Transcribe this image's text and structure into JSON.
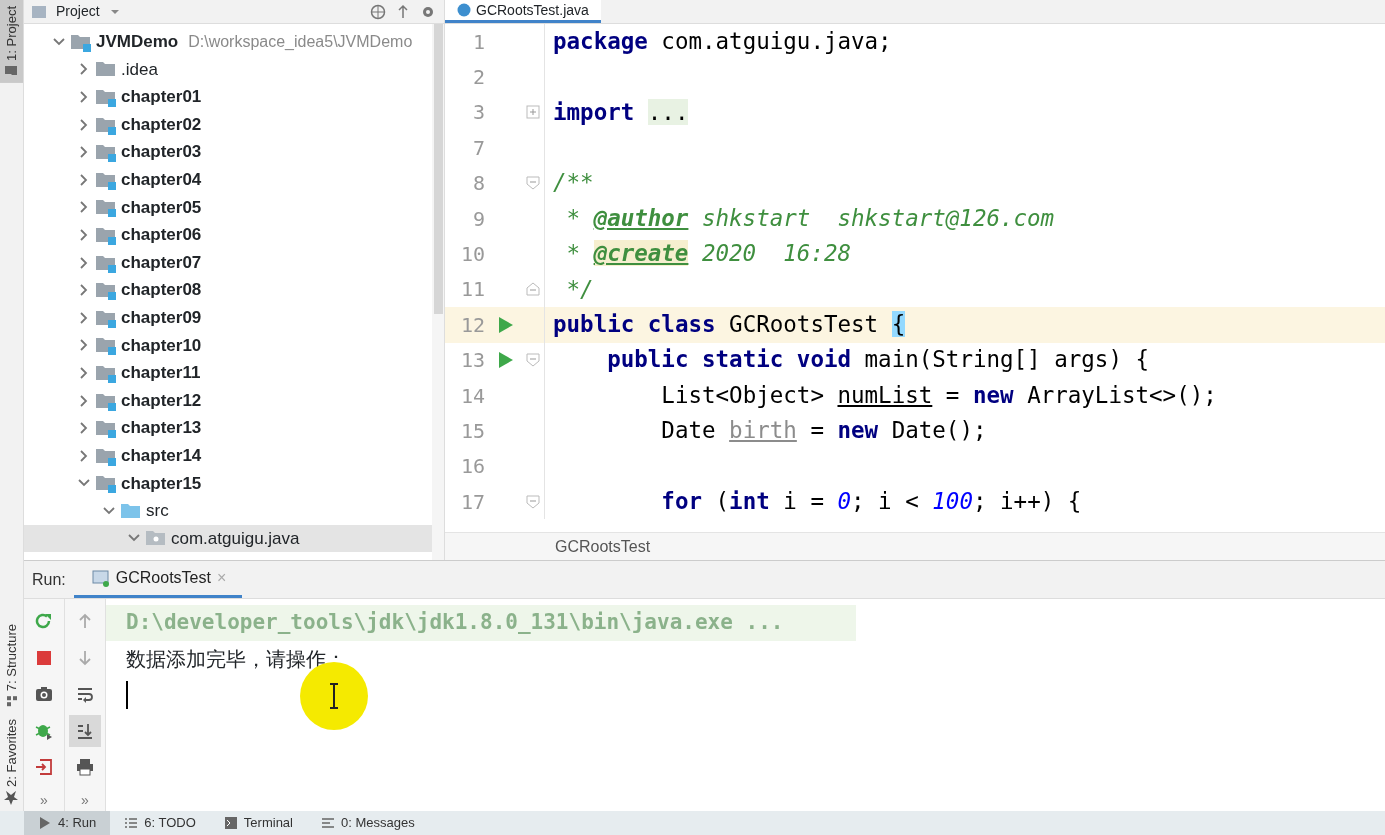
{
  "side_strip": [
    {
      "label": "1: Project",
      "selected": true
    },
    {
      "label": "7: Structure",
      "selected": false
    },
    {
      "label": "2: Favorites",
      "selected": false
    }
  ],
  "project_pane": {
    "title": "Project",
    "tree": [
      {
        "name": "JVMDemo",
        "path": "D:\\workspace_idea5\\JVMDemo",
        "kind": "module",
        "bold": true,
        "expanded": true,
        "selected": false,
        "children": [
          {
            "name": ".idea",
            "kind": "folder",
            "bold": false,
            "expanded": false,
            "selected": false
          },
          {
            "name": "chapter01",
            "kind": "module",
            "bold": true,
            "expanded": false,
            "selected": false
          },
          {
            "name": "chapter02",
            "kind": "module",
            "bold": true,
            "expanded": false,
            "selected": false
          },
          {
            "name": "chapter03",
            "kind": "module",
            "bold": true,
            "expanded": false,
            "selected": false
          },
          {
            "name": "chapter04",
            "kind": "module",
            "bold": true,
            "expanded": false,
            "selected": false
          },
          {
            "name": "chapter05",
            "kind": "module",
            "bold": true,
            "expanded": false,
            "selected": false
          },
          {
            "name": "chapter06",
            "kind": "module",
            "bold": true,
            "expanded": false,
            "selected": false
          },
          {
            "name": "chapter07",
            "kind": "module",
            "bold": true,
            "expanded": false,
            "selected": false
          },
          {
            "name": "chapter08",
            "kind": "module",
            "bold": true,
            "expanded": false,
            "selected": false
          },
          {
            "name": "chapter09",
            "kind": "module",
            "bold": true,
            "expanded": false,
            "selected": false
          },
          {
            "name": "chapter10",
            "kind": "module",
            "bold": true,
            "expanded": false,
            "selected": false
          },
          {
            "name": "chapter11",
            "kind": "module",
            "bold": true,
            "expanded": false,
            "selected": false
          },
          {
            "name": "chapter12",
            "kind": "module",
            "bold": true,
            "expanded": false,
            "selected": false
          },
          {
            "name": "chapter13",
            "kind": "module",
            "bold": true,
            "expanded": false,
            "selected": false
          },
          {
            "name": "chapter14",
            "kind": "module",
            "bold": true,
            "expanded": false,
            "selected": false
          },
          {
            "name": "chapter15",
            "kind": "module",
            "bold": true,
            "expanded": true,
            "selected": false,
            "children": [
              {
                "name": "src",
                "kind": "source",
                "bold": false,
                "expanded": true,
                "selected": false,
                "children": [
                  {
                    "name": "com.atguigu.java",
                    "kind": "package",
                    "bold": false,
                    "expanded": true,
                    "selected": true
                  }
                ]
              }
            ]
          }
        ]
      }
    ]
  },
  "editor": {
    "tab": "GCRootsTest.java",
    "lines": [
      {
        "number": "1",
        "run": false,
        "current": false,
        "tokens": [
          {
            "kind": "keyword",
            "text": "package"
          },
          {
            "kind": "plain",
            "text": " com.atguigu.java;"
          }
        ]
      },
      {
        "number": "2",
        "run": false,
        "current": false
      },
      {
        "number": "3",
        "run": false,
        "fold_marker": {
          "kind": "expand"
        },
        "current": false,
        "tokens": [
          {
            "kind": "keyword",
            "text": "import "
          },
          {
            "kind": "folded",
            "text": "..."
          }
        ]
      },
      {
        "number": "7",
        "run": false,
        "current": false
      },
      {
        "number": "8",
        "run": false,
        "fold_marker": {
          "kind": "start"
        },
        "current": false,
        "tokens": [
          {
            "kind": "comment",
            "text": "/**"
          }
        ]
      },
      {
        "number": "9",
        "run": false,
        "current": false,
        "tokens": [
          {
            "kind": "comment",
            "text": " *"
          },
          {
            "kind": "doctag",
            "text": "@author"
          },
          {
            "kind": "comment",
            "text": " shkstart  shkstart@126.com"
          }
        ]
      },
      {
        "number": "10",
        "run": false,
        "current": false,
        "tokens": [
          {
            "kind": "comment",
            "text": " *"
          },
          {
            "kind": "doctag-marked",
            "text": "@create"
          },
          {
            "kind": "comment",
            "text": " 2020  16:28"
          }
        ]
      },
      {
        "number": "11",
        "run": false,
        "fold_marker": {
          "kind": "end"
        },
        "current": false,
        "tokens": [
          {
            "kind": "comment",
            "text": " */"
          }
        ]
      },
      {
        "number": "12",
        "run": true,
        "current": true,
        "tokens": [
          {
            "kind": "keyword",
            "text": "public class"
          },
          {
            "kind": "plain",
            "text": " GCRootsTest "
          },
          {
            "kind": "brace-match",
            "text": "{"
          }
        ]
      },
      {
        "number": "13",
        "run": true,
        "fold_marker": {
          "kind": "start"
        },
        "current": false,
        "tokens": [
          {
            "kind": "keyword",
            "text": "    public static void"
          },
          {
            "kind": "plain",
            "text": " main(String[] args) {"
          }
        ]
      },
      {
        "number": "14",
        "run": false,
        "current": false,
        "tokens": [
          {
            "kind": "plain",
            "text": "        List<Object> "
          },
          {
            "kind": "underlined",
            "text": "numList"
          },
          {
            "kind": "plain",
            "text": " = "
          },
          {
            "kind": "keyword",
            "text": "new"
          },
          {
            "kind": "plain",
            "text": " ArrayList<>();"
          }
        ]
      },
      {
        "number": "15",
        "run": false,
        "current": false,
        "tokens": [
          {
            "kind": "plain",
            "text": "        Date "
          },
          {
            "kind": "unused",
            "text": "birth"
          },
          {
            "kind": "plain",
            "text": " = "
          },
          {
            "kind": "keyword",
            "text": "new"
          },
          {
            "kind": "plain",
            "text": " Date();"
          }
        ]
      },
      {
        "number": "16",
        "run": false,
        "current": false
      },
      {
        "number": "17",
        "run": false,
        "fold_marker": {
          "kind": "start"
        },
        "current": false,
        "tokens": [
          {
            "kind": "keyword",
            "text": "        for"
          },
          {
            "kind": "plain",
            "text": " ("
          },
          {
            "kind": "keyword",
            "text": "int"
          },
          {
            "kind": "plain",
            "text": " i = "
          },
          {
            "kind": "number",
            "text": "0"
          },
          {
            "kind": "plain",
            "text": "; i < "
          },
          {
            "kind": "number",
            "text": "100"
          },
          {
            "kind": "plain",
            "text": "; i++) {"
          }
        ]
      }
    ],
    "breadcrumb": "GCRootsTest"
  },
  "run_panel": {
    "label": "Run:",
    "tab": "GCRootsTest",
    "close": "×",
    "toolbar_left": [
      {
        "kind": "rerun",
        "selected": false
      },
      {
        "kind": "stop",
        "selected": false
      },
      {
        "kind": "camera",
        "selected": false
      },
      {
        "kind": "bug",
        "selected": false
      },
      {
        "kind": "exit",
        "selected": false
      }
    ],
    "toolbar_right": [
      {
        "kind": "up",
        "selected": false
      },
      {
        "kind": "down",
        "selected": false
      },
      {
        "kind": "wrap",
        "selected": false
      },
      {
        "kind": "scroll-end",
        "selected": true
      },
      {
        "kind": "print",
        "selected": false
      }
    ],
    "more": [
      "»",
      "»"
    ],
    "console": [
      {
        "kind": "command",
        "text": "D:\\developer_tools\\jdk\\jdk1.8.0_131\\bin\\java.exe ..."
      },
      {
        "kind": "output",
        "text": "数据添加完毕，请操作："
      }
    ]
  },
  "bottom_bar": [
    {
      "label": "4: Run",
      "selected": true
    },
    {
      "label": "6: TODO",
      "selected": false
    },
    {
      "label": "Terminal",
      "selected": false
    },
    {
      "label": "0: Messages",
      "selected": false
    }
  ]
}
